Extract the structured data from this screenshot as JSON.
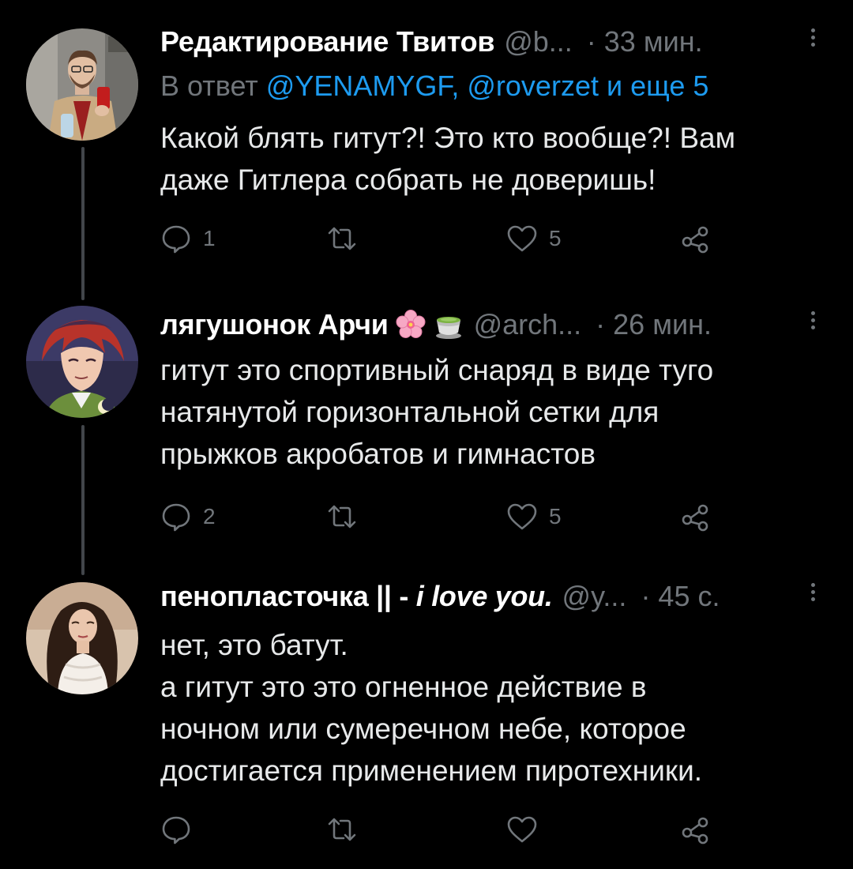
{
  "colors": {
    "background": "#000000",
    "text": "#e7e9ea",
    "secondary": "#71767b",
    "link": "#1d9bf0",
    "thread_line": "#42464b"
  },
  "tweets": [
    {
      "display_name": "Редактирование Твитов",
      "emojis": [],
      "handle": "@b...",
      "time": "· 33 мин.",
      "reply_prefix": "В ответ",
      "reply_links": "@YENAMYGF, @roverzet",
      "reply_suffix": "и еще 5",
      "lines": [
        "Какой блять гитут?! Это кто вообще?! Вам",
        "даже Гитлера собрать не доверишь!"
      ],
      "reply_count": "1",
      "retweet_count": "",
      "like_count": "5",
      "avatar_icon": "man-photo-avatar",
      "more_icon": "more-vertical-icon"
    },
    {
      "display_name": "лягушонок Арчи",
      "emojis": [
        "cherry-blossom-emoji",
        "green-tea-emoji"
      ],
      "handle": "@arch...",
      "time": "· 26 мин.",
      "lines": [
        "гитут это спортивный снаряд в виде туго",
        "натянутой горизонтальной сетки для",
        "прыжков акробатов и гимнастов"
      ],
      "reply_count": "2",
      "retweet_count": "",
      "like_count": "5",
      "avatar_icon": "anime-character-avatar",
      "more_icon": "more-vertical-icon"
    },
    {
      "display_name": "пенопласточка || - ",
      "display_name_italic": "i love you.",
      "emojis": [],
      "handle": "@y...",
      "time": "· 45 с.",
      "lines": [
        "нет, это батут.",
        "а гитут это это огненное действие в",
        "ночном или сумеречном небе, которое",
        "достигается применением пиротехники."
      ],
      "reply_count": "",
      "retweet_count": "",
      "like_count": "",
      "avatar_icon": "woman-photo-avatar",
      "more_icon": "more-vertical-icon"
    }
  ],
  "icons": {
    "reply": "reply-icon",
    "retweet": "retweet-icon",
    "like": "heart-icon",
    "share": "share-icon"
  }
}
